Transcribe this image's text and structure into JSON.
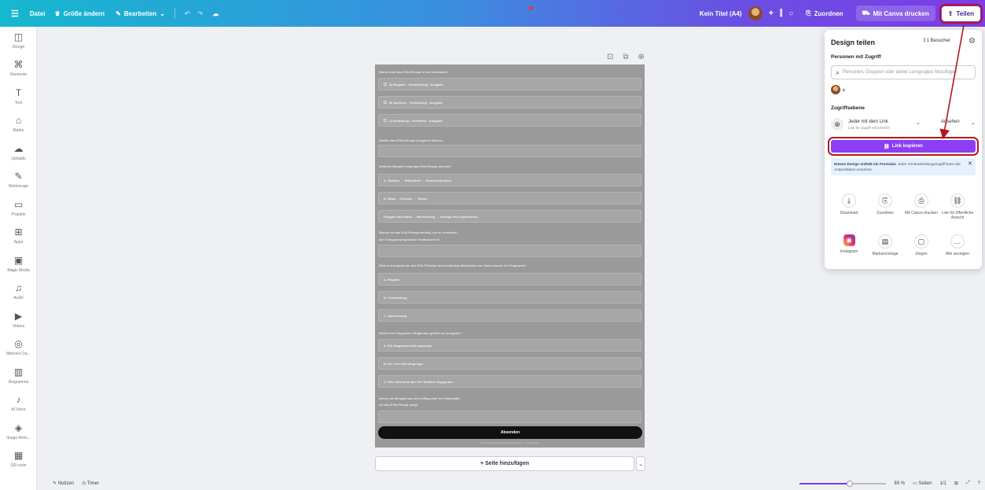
{
  "topbar": {
    "menu_icon": "hamburger-icon",
    "file_label": "Datei",
    "resize_label": "Größe ändern",
    "edit_label": "Bearbeiten",
    "doc_title": "Kein Titel (A4)",
    "assign_label": "Zuordnen",
    "print_label": "Mit Canva drucken",
    "share_label": "Teilen",
    "add_collaborator": "+"
  },
  "sidebar": {
    "items": [
      {
        "label": "Design",
        "icon": "layout-icon",
        "glyph": "◫"
      },
      {
        "label": "Elemente",
        "icon": "elements-icon",
        "glyph": "⌘"
      },
      {
        "label": "Text",
        "icon": "text-icon",
        "glyph": "T"
      },
      {
        "label": "Marke",
        "icon": "brand-icon",
        "glyph": "⌂"
      },
      {
        "label": "Uploads",
        "icon": "cloud-upload-icon",
        "glyph": "☁"
      },
      {
        "label": "Werkzeuge",
        "icon": "draw-icon",
        "glyph": "✎"
      },
      {
        "label": "Projekte",
        "icon": "folder-icon",
        "glyph": "▭"
      },
      {
        "label": "Apps",
        "icon": "apps-icon",
        "glyph": "⊞"
      },
      {
        "label": "Magic Media",
        "icon": "magic-media-icon",
        "glyph": "▣"
      },
      {
        "label": "Audio",
        "icon": "audio-icon",
        "glyph": "♫"
      },
      {
        "label": "Videos",
        "icon": "video-icon",
        "glyph": "▶"
      },
      {
        "label": "Mehrere Da...",
        "icon": "data-icon",
        "glyph": "◎"
      },
      {
        "label": "Diagramme",
        "icon": "chart-icon",
        "glyph": "▥"
      },
      {
        "label": "AI Voice",
        "icon": "ai-voice-icon",
        "glyph": "♪"
      },
      {
        "label": "Image Anim...",
        "icon": "image-anim-icon",
        "glyph": "◈"
      },
      {
        "label": "QR-code",
        "icon": "qr-code-icon",
        "glyph": "▦"
      }
    ]
  },
  "page": {
    "questions": [
      "Worin sieht das EVA-Prinzip in der Informatik?",
      "Erkläre das EVA-Prinzip in eigenen Worten.",
      "Welches Beispiel zeigt das EVA-Prinzip korrekt?",
      "Warum ist das EVA-Prinzip wichtig, um zu verstehen,",
      "Welche Komponente des EVA-Prinzips beschreibt das Bearbeiten von Daten durch ein Programm?",
      "Welche der folgenden Tätigkeiten gehört zur Ausgabe?",
      "Nenne ein Beispiel aus dem Alltag oder der Informatik,"
    ],
    "question_line2": [
      "wie Computerprogramme funktionieren?",
      "wo das EVA-Prinzip steigt."
    ],
    "options": [
      "A) Eingabe · Verarbeitung · Ausgabe",
      "B) Speicher · Verbindung · Ausgabe",
      "C) Ermittlung · Verfahren · Ausgabe",
      "A. Tastatur → Bildschirm → Rechenoperation",
      "B. Maus → Drucker → Tasten",
      "Eingabe von Daten → Berechnung → Anzeige des Ergebnisses",
      "A. Eingabe",
      "B. Verarbeitung",
      "C. Speicherung",
      "A. Ein Diagramm wird angezeigt",
      "B. Ein Text wird eingetippt",
      "C. Eine Zahl wird über die Tastatur eingegeben"
    ],
    "submit_label": "Absenden",
    "footer_note": "Formular-Antworten werden gespeichert · Datenschutz"
  },
  "add_page_label": "+ Seite hinzufügen",
  "bottombar": {
    "notes_label": "Notizen",
    "timer_label": "Timer",
    "zoom_level": "89 %",
    "zoom_fraction": 0.58,
    "pages_label": "Seiten",
    "page_count": "1/1"
  },
  "share_panel": {
    "title": "Design teilen",
    "visitors": "1 Besucher",
    "people_heading": "Personen mit Zugriff",
    "search_placeholder": "Personen, Gruppen oder deine Lerngruppe hinzufügen",
    "access_heading": "Zugriffsebene",
    "access_title": "Jeder mit dem Link",
    "access_sub": "Link für Zugriff erforderlich",
    "access_role": "Ansehen",
    "copy_link_label": "Link kopieren",
    "info_bold": "Dieses Design enthält ein Formular.",
    "info_text": "Jeder mit Bearbeitungszugriff kann die Antwortdaten einsehen.",
    "actions": [
      {
        "label": "Download",
        "icon": "download-icon",
        "glyph": "⤓"
      },
      {
        "label": "Zuordnen",
        "icon": "assign-icon",
        "glyph": "⎘"
      },
      {
        "label": "Mit Canva drucken",
        "icon": "print-icon",
        "glyph": "⎙"
      },
      {
        "label": "Link für öffentliche Ansicht",
        "icon": "link-icon",
        "glyph": "⛓"
      },
      {
        "label": "Instagram",
        "icon": "instagram-icon",
        "glyph": "◉"
      },
      {
        "label": "Markenvorlage",
        "icon": "template-icon",
        "glyph": "▤"
      },
      {
        "label": "Zeigen",
        "icon": "present-icon",
        "glyph": "▢"
      },
      {
        "label": "Alle anzeigen",
        "icon": "more-icon",
        "glyph": "…"
      }
    ]
  },
  "colors": {
    "accent": "#8b3ef3",
    "highlight": "#b0181f"
  }
}
